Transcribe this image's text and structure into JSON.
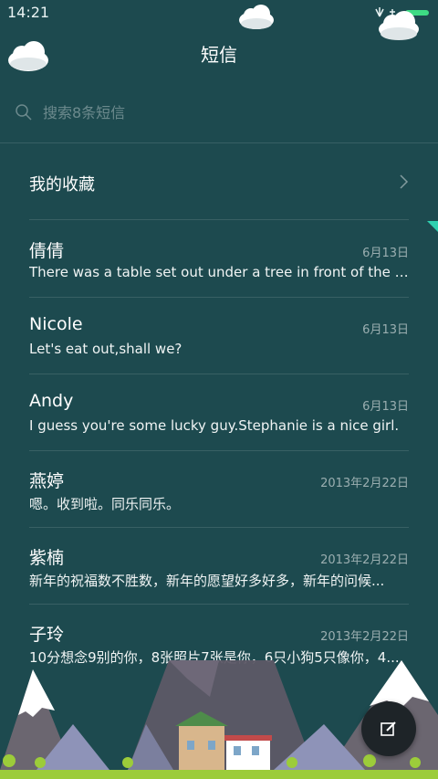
{
  "status_bar": {
    "time": "14:21"
  },
  "header": {
    "title": "短信"
  },
  "search": {
    "placeholder": "搜索8条短信"
  },
  "favorites": {
    "label": "我的收藏"
  },
  "messages": [
    {
      "name": "倩倩",
      "date": "6月13日",
      "preview": "There was a table set out under a tree in front of the ho..."
    },
    {
      "name": "Nicole",
      "date": "6月13日",
      "preview": "Let's eat out,shall we?"
    },
    {
      "name": "Andy",
      "date": "6月13日",
      "preview": "I guess you're some lucky guy.Stephanie is a nice girl."
    },
    {
      "name": "燕婷",
      "date": "2013年2月22日",
      "preview": "嗯。收到啦。同乐同乐。"
    },
    {
      "name": "紫楠",
      "date": "2013年2月22日",
      "preview": "新年的祝福数不胜数，新年的愿望好多好多，新年的问候..."
    },
    {
      "name": "子玲",
      "date": "2013年2月22日",
      "preview": "10分想念9别的你，8张照片7张是你，6只小狗5只像你，4..."
    }
  ],
  "icons": {
    "search": "search-icon",
    "chevron": "chevron-right-icon",
    "compose": "compose-icon",
    "cloud": "cloud-icon"
  },
  "colors": {
    "background": "#1d4a4f",
    "accent": "#2fd0b0",
    "battery": "#3ddc84",
    "compose_button": "#1e2428"
  }
}
